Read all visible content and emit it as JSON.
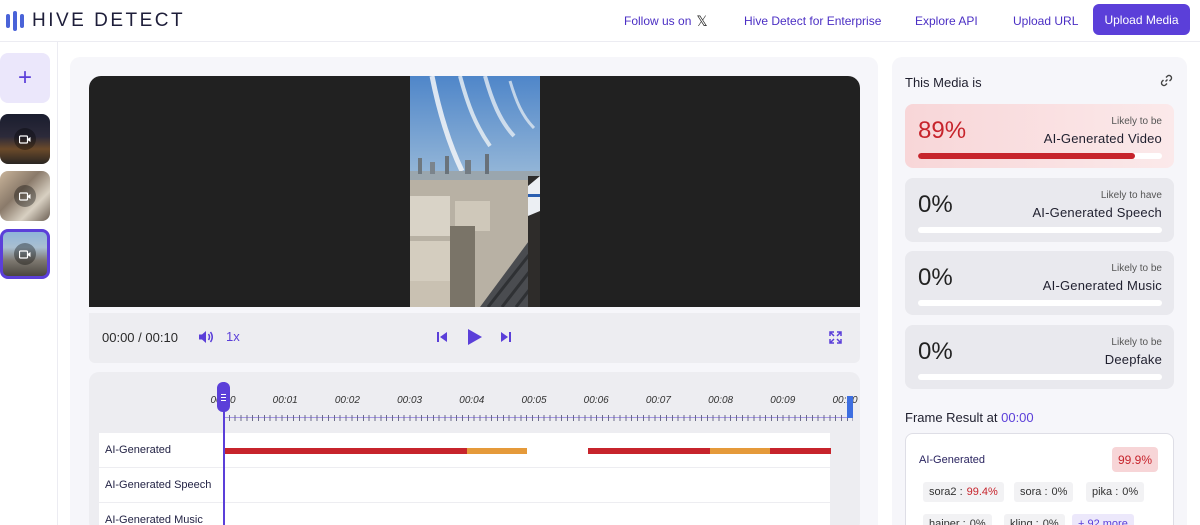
{
  "brand": {
    "name": "HIVE DETECT"
  },
  "nav": {
    "follow_label": "Follow us on",
    "follow_icon": "x-logo-icon",
    "enterprise_label": "Hive Detect for Enterprise",
    "api_label": "Explore API",
    "upload_url_label": "Upload URL",
    "upload_media_label": "Upload Media"
  },
  "rail": {
    "add_glyph": "+"
  },
  "player": {
    "time_current": "00:00",
    "time_separator": " / ",
    "time_total": "00:10",
    "speed": "1x"
  },
  "timeline": {
    "ticks": [
      "00:00",
      "00:01",
      "00:02",
      "00:03",
      "00:04",
      "00:05",
      "00:06",
      "00:07",
      "00:08",
      "00:09",
      "00:10"
    ],
    "tracks": [
      {
        "label": "AI-Generated",
        "segments": [
          {
            "from": 0,
            "to": 4,
            "level": "high"
          },
          {
            "from": 4,
            "to": 5,
            "level": "medium"
          },
          {
            "from": 6,
            "to": 8,
            "level": "high"
          },
          {
            "from": 8,
            "to": 9,
            "level": "medium"
          },
          {
            "from": 9,
            "to": 10,
            "level": "high"
          }
        ]
      },
      {
        "label": "AI-Generated Speech",
        "segments": []
      },
      {
        "label": "AI-Generated Music",
        "segments": []
      }
    ]
  },
  "results": {
    "title": "This Media is",
    "cards": [
      {
        "percent": "89%",
        "value": 0.89,
        "qualifier": "Likely to be",
        "label": "AI-Generated Video",
        "flagged": true
      },
      {
        "percent": "0%",
        "value": 0,
        "qualifier": "Likely to have",
        "label": "AI-Generated Speech",
        "flagged": false
      },
      {
        "percent": "0%",
        "value": 0,
        "qualifier": "Likely to be",
        "label": "AI-Generated Music",
        "flagged": false
      },
      {
        "percent": "0%",
        "value": 0,
        "qualifier": "Likely to be",
        "label": "Deepfake",
        "flagged": false
      }
    ],
    "frame_title": "Frame Result at",
    "frame_time": "00:00",
    "frame_label": "AI-Generated",
    "frame_score": "99.9%",
    "models": [
      {
        "name": "sora2 :",
        "score": "99.4%",
        "flagged": true
      },
      {
        "name": "sora :",
        "score": "0%",
        "flagged": false
      },
      {
        "name": "pika :",
        "score": "0%",
        "flagged": false
      },
      {
        "name": "haiper :",
        "score": "0%",
        "flagged": false
      },
      {
        "name": "kling :",
        "score": "0%",
        "flagged": false
      }
    ],
    "more_label": "+ 92 more"
  },
  "colors": {
    "accent": "#5b3fd9",
    "high": "#c7242c",
    "medium": "#e59a3a"
  }
}
